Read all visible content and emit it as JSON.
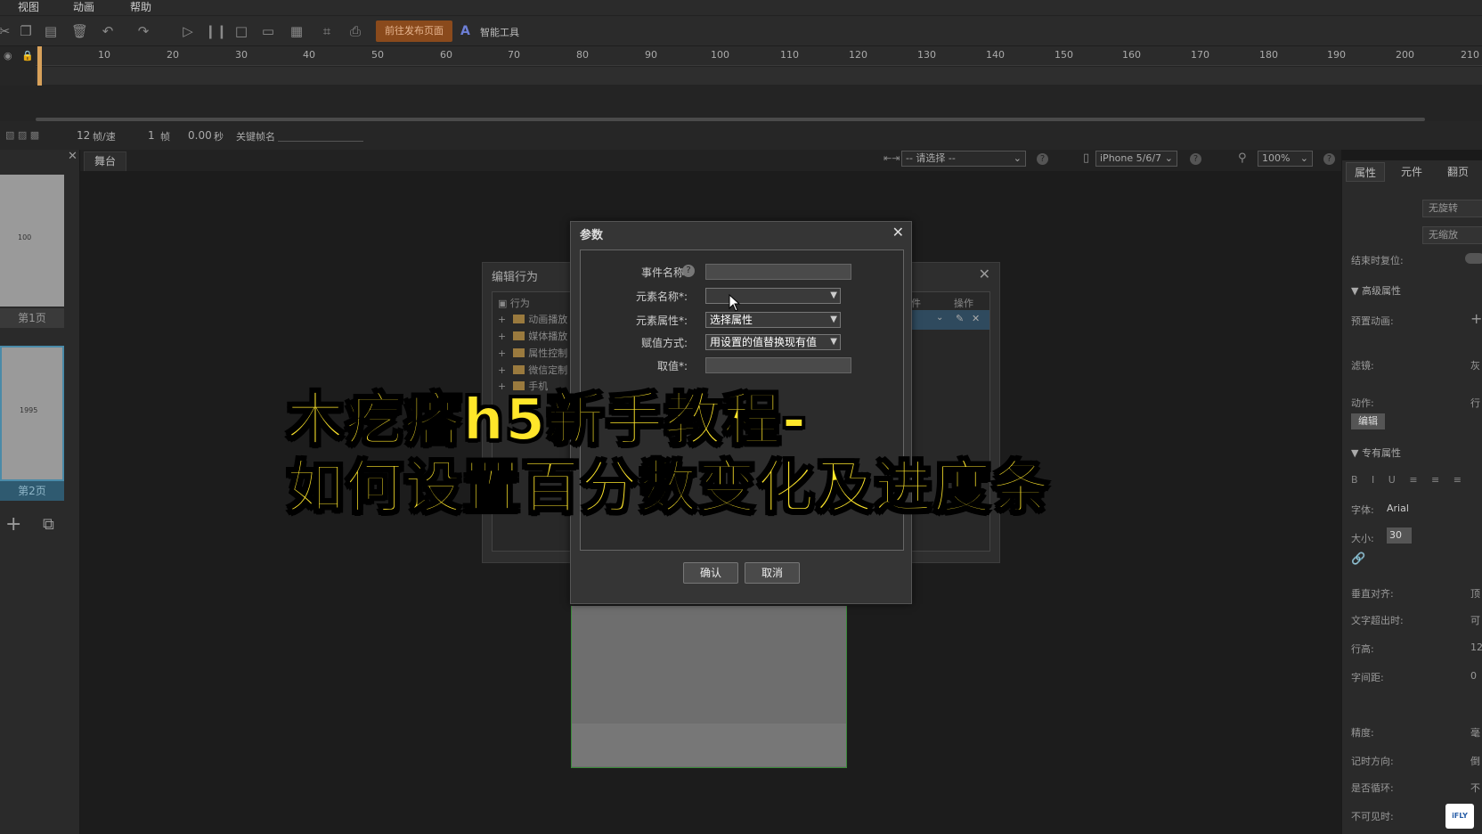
{
  "menu": {
    "view": "视图",
    "animation": "动画",
    "help": "帮助"
  },
  "toolbar": {
    "publish_label": "前往发布页面",
    "ai_label": "智能工具"
  },
  "timeline": {
    "ticks": [
      "10",
      "20",
      "30",
      "40",
      "50",
      "60",
      "70",
      "80",
      "90",
      "100",
      "110",
      "120",
      "130",
      "140",
      "150",
      "160",
      "170",
      "180",
      "190",
      "200",
      "210"
    ]
  },
  "status": {
    "fps_value": "12",
    "fps_label": "帧/速",
    "frame_value": "1",
    "frame_label": "帧",
    "time_value": "0.00",
    "time_label": "秒",
    "keyframe_label": "关键帧名"
  },
  "pages": [
    {
      "label": "第1页",
      "thumb_text": "100"
    },
    {
      "label": "第2页",
      "thumb_text": "1995"
    }
  ],
  "stage": {
    "tab_label": "舞台",
    "select_placeholder": "-- 请选择 --",
    "device": "iPhone 5/6/7",
    "zoom": "100%"
  },
  "right_panel": {
    "tabs": [
      "属性",
      "元件",
      "翻页"
    ],
    "no_rotate": "无旋转",
    "no_scale": "无缩放",
    "reset_on_end": "结束时复位:",
    "advanced_section": "高级属性",
    "preset_anim": "预置动画:",
    "filter": "滤镜:",
    "filter_value": "灰",
    "action": "动作:",
    "action_value": "行",
    "edit_button": "编辑",
    "exclusive_section": "专有属性",
    "font_label": "字体:",
    "font_value": "Arial",
    "size_label": "大小:",
    "size_value": "30",
    "valign_label": "垂直对齐:",
    "valign_value": "顶",
    "overflow_label": "文字超出时:",
    "overflow_value": "可",
    "line_height_label": "行高:",
    "line_height_value": "12",
    "letter_spacing_label": "字间距:",
    "letter_spacing_value": "0",
    "precision_label": "精度:",
    "precision_value": "毫",
    "timer_dir_label": "记时方向:",
    "timer_dir_value": "倒",
    "loop_label": "是否循环:",
    "loop_value": "不",
    "invisible_label": "不可见时:"
  },
  "behavior_dialog": {
    "title": "编辑行为",
    "tree_root": "行为",
    "items": [
      "动画播放",
      "媒体播放",
      "属性控制",
      "微信定制",
      "手机"
    ],
    "col_element": "件",
    "col_action": "操作",
    "trigger_label": "件"
  },
  "param_dialog": {
    "title": "参数",
    "event_name_label": "事件名称:",
    "element_name_label": "元素名称*:",
    "element_prop_label": "元素属性*:",
    "element_prop_value": "选择属性",
    "assign_label": "赋值方式:",
    "assign_value": "用设置的值替换现有值",
    "value_label": "取值*:",
    "confirm": "确认",
    "cancel": "取消"
  },
  "overlay": {
    "line1": "木疙瘩h5新手教程-",
    "line2": "如何设置百分数变化及进度条"
  },
  "colors": {
    "accent_publish": "#8a4a1c",
    "overlay_text": "#ffe62a",
    "playhead": "#d8a15a"
  }
}
